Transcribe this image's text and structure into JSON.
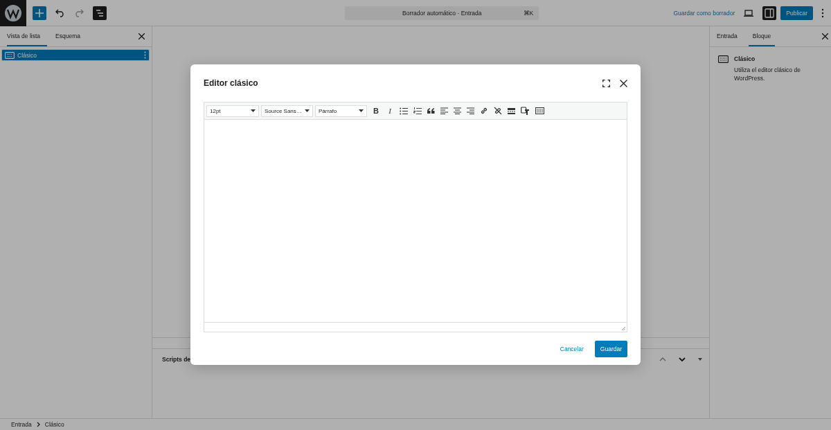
{
  "top_bar": {
    "command_bar": {
      "title": "Borrador automático · Entrada",
      "shortcut": "⌘K"
    },
    "save_draft": "Guardar como borrador",
    "publish": "Publicar",
    "settings_open": true
  },
  "left_panel": {
    "tabs": [
      {
        "label": "Vista de lista",
        "selected": true
      },
      {
        "label": "Esquema",
        "selected": false
      }
    ],
    "items": [
      {
        "label": "Clásico",
        "selected": true
      }
    ]
  },
  "meta_box": {
    "title": "Scripts de"
  },
  "right_panel": {
    "tabs": [
      {
        "label": "Entrada",
        "selected": false
      },
      {
        "label": "Bloque",
        "selected": true
      }
    ],
    "block": {
      "name": "Clásico",
      "description": "Utiliza el editor clásico de WordPress."
    }
  },
  "breadcrumb": [
    "Entrada",
    "Clásico"
  ],
  "modal": {
    "title": "Editor clásico",
    "selects": [
      "12pt",
      "Source Sans…",
      "Párrafo"
    ],
    "tools": [
      {
        "kind": "bold",
        "label": "B"
      },
      {
        "kind": "italic",
        "label": "I"
      },
      {
        "kind": "bullets"
      },
      {
        "kind": "numbers"
      },
      {
        "kind": "quote"
      },
      {
        "kind": "align-left"
      },
      {
        "kind": "align-center"
      },
      {
        "kind": "align-right"
      },
      {
        "kind": "link"
      },
      {
        "kind": "unlink"
      },
      {
        "kind": "more"
      },
      {
        "kind": "paste"
      },
      {
        "kind": "keyboard"
      }
    ],
    "cancel": "Cancelar",
    "save": "Guardar"
  }
}
